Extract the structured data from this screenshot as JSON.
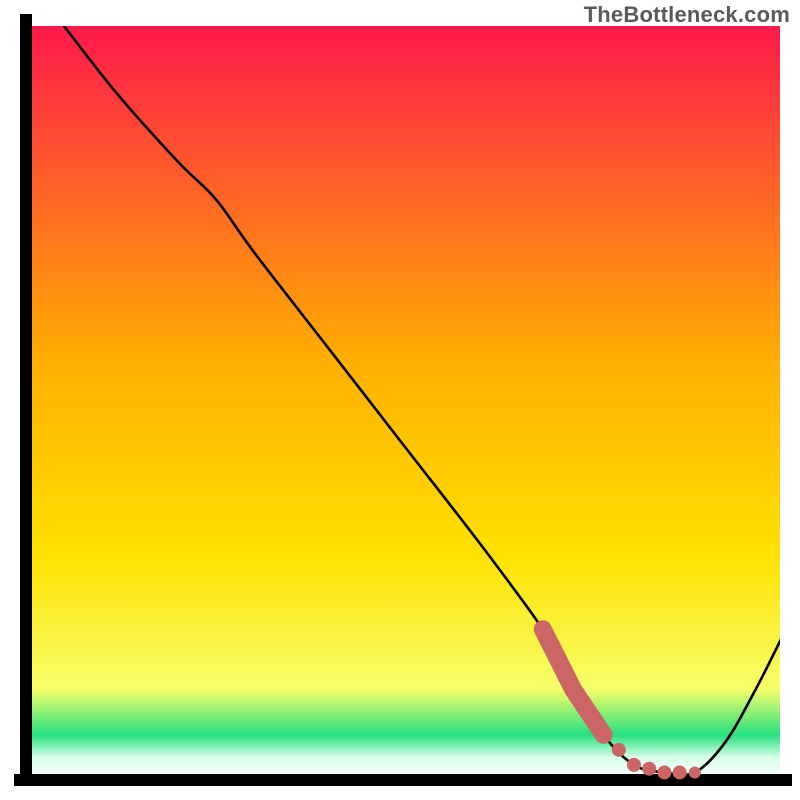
{
  "watermark": "TheBottleneck.com",
  "colors": {
    "axis": "#000000",
    "curve": "#000000",
    "marker": "#cc6666",
    "gradient_top": "#ff1a4b",
    "gradient_mid": "#ffd400",
    "gradient_low": "#f6ff6a",
    "gradient_green": "#26e07f",
    "gradient_bottom": "#ffffff"
  },
  "chart_data": {
    "type": "line",
    "title": "",
    "xlabel": "",
    "ylabel": "",
    "xlim": [
      0,
      100
    ],
    "ylim": [
      0,
      100
    ],
    "grid": false,
    "legend": false,
    "series": [
      {
        "name": "bottleneck-curve",
        "x": [
          5,
          12,
          20,
          25,
          30,
          40,
          50,
          60,
          68,
          72,
          76,
          80,
          84,
          88,
          92,
          96,
          100
        ],
        "values": [
          100,
          91,
          82,
          77,
          70,
          57,
          44,
          31,
          20,
          13,
          6,
          2,
          1,
          1,
          5,
          12,
          20
        ]
      }
    ],
    "markers": {
      "name": "highlight-points",
      "x": [
        68,
        70,
        72,
        74,
        76,
        78,
        80,
        82,
        84,
        86,
        88
      ],
      "values": [
        20,
        16,
        12,
        9,
        6,
        4,
        2,
        1.5,
        1,
        1,
        1
      ]
    }
  }
}
